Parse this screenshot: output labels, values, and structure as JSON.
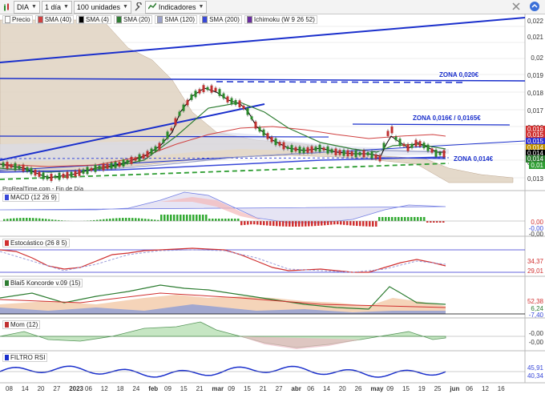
{
  "toolbar": {
    "symbol": "DIA",
    "period": "1 día",
    "units": "100 unidades",
    "indicators": "Indicadores"
  },
  "legend": [
    {
      "label": "Precio",
      "color": "#ffffff"
    },
    {
      "label": "SMA (40)",
      "color": "#d04040"
    },
    {
      "label": "SMA (4)",
      "color": "#000000"
    },
    {
      "label": "SMA (20)",
      "color": "#2e7d32"
    },
    {
      "label": "SMA (120)",
      "color": "#9aa0c8"
    },
    {
      "label": "SMA (200)",
      "color": "#3848d8"
    },
    {
      "label": "Ichimoku (W 9 26 52)",
      "color": "#6a2ca0"
    }
  ],
  "price_axis": [
    "0,022",
    "0,021",
    "0,02",
    "0,019",
    "0,018",
    "0,017",
    "0,016",
    "0,015",
    "0,014",
    "0,013"
  ],
  "price_tags": [
    {
      "text": "0,016",
      "color": "#d03030"
    },
    {
      "text": "0,015",
      "color": "#d03030"
    },
    {
      "text": "0,015",
      "color": "#3030d0"
    },
    {
      "text": "0,014",
      "color": "#c09000"
    },
    {
      "text": "0,014",
      "color": "#000000"
    },
    {
      "text": "0,014",
      "color": "#2e7d32"
    },
    {
      "text": "0,01",
      "color": "#2e9d32"
    }
  ],
  "zones": [
    "ZONA 0,020€",
    "ZONA 0,016€ / 0,0165€",
    "ZONA 0,014€"
  ],
  "source": "ProRealTime.com - Fin de Día",
  "macd": {
    "title": "MACD (12 26 9)",
    "values": [
      "0,00",
      "-0,00",
      "-0,00"
    ]
  },
  "stoch": {
    "title": "Estocástico (26 8 5)",
    "values": [
      "34,37",
      "29,01"
    ]
  },
  "koncorde": {
    "title": "Blai5 Koncorde v.09 (15)",
    "values": [
      "52,38",
      "6,24",
      "-7,40"
    ]
  },
  "mom": {
    "title": "Mom (12)",
    "values": [
      "-0,00",
      "-0,00"
    ]
  },
  "rsi": {
    "title": "FILTRO RSI",
    "values": [
      "45,91",
      "40,34"
    ]
  },
  "dates": [
    {
      "t": "08",
      "b": false
    },
    {
      "t": "14",
      "b": false
    },
    {
      "t": "20",
      "b": false
    },
    {
      "t": "27",
      "b": false
    },
    {
      "t": "2023",
      "b": true
    },
    {
      "t": "06",
      "b": false
    },
    {
      "t": "12",
      "b": false
    },
    {
      "t": "18",
      "b": false
    },
    {
      "t": "24",
      "b": false
    },
    {
      "t": "feb",
      "b": true
    },
    {
      "t": "09",
      "b": false
    },
    {
      "t": "15",
      "b": false
    },
    {
      "t": "21",
      "b": false
    },
    {
      "t": "mar",
      "b": true
    },
    {
      "t": "09",
      "b": false
    },
    {
      "t": "15",
      "b": false
    },
    {
      "t": "21",
      "b": false
    },
    {
      "t": "27",
      "b": false
    },
    {
      "t": "abr",
      "b": true
    },
    {
      "t": "06",
      "b": false
    },
    {
      "t": "14",
      "b": false
    },
    {
      "t": "20",
      "b": false
    },
    {
      "t": "26",
      "b": false
    },
    {
      "t": "may",
      "b": true
    },
    {
      "t": "09",
      "b": false
    },
    {
      "t": "15",
      "b": false
    },
    {
      "t": "19",
      "b": false
    },
    {
      "t": "25",
      "b": false
    },
    {
      "t": "jun",
      "b": true
    },
    {
      "t": "06",
      "b": false
    },
    {
      "t": "12",
      "b": false
    },
    {
      "t": "16",
      "b": false
    }
  ]
}
